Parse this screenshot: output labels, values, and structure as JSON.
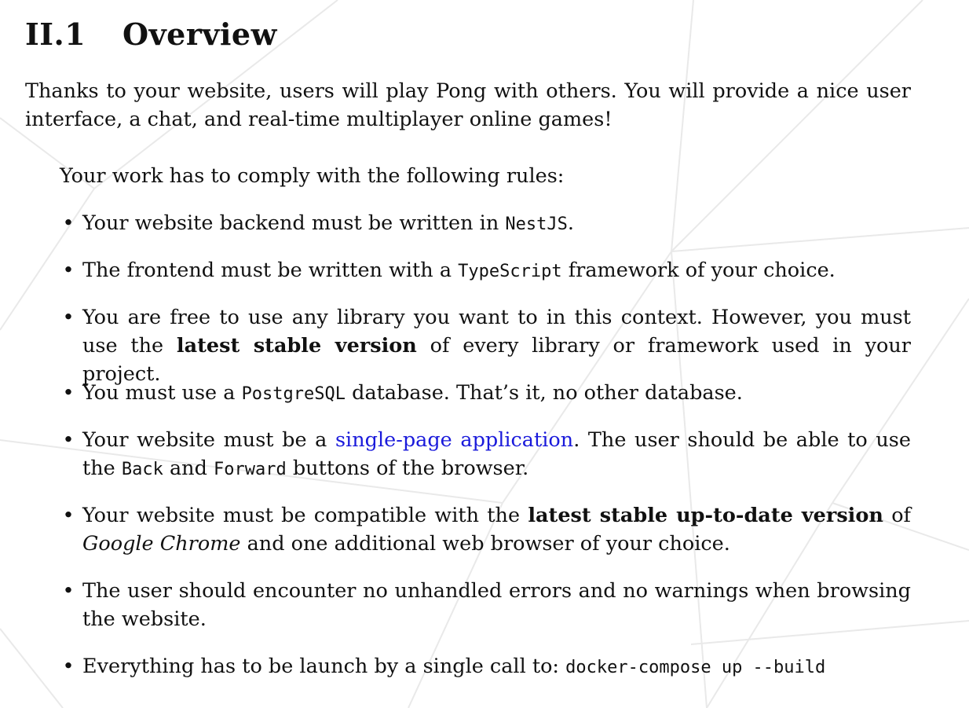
{
  "section": {
    "number": "II.1",
    "title": "Overview"
  },
  "intro": {
    "text": "Thanks to your website, users will play Pong with others. You will provide a nice user interface, a chat, and real-time multiplayer online games!"
  },
  "rules_lead": "Your work has to comply with the following rules:",
  "bullet_symbol": "•",
  "rules": [
    {
      "before": "Your website backend must be written in ",
      "code": "NestJS",
      "after": "."
    },
    {
      "before": "The frontend must be written with a ",
      "code": "TypeScript",
      "after": " framework of your choice."
    },
    {
      "before": "You are free to use any library you want to in this context. However, you must use the ",
      "bold": "latest stable version",
      "after": " of every library or framework used in your project."
    },
    {
      "before": "You must use a ",
      "code": "PostgreSQL",
      "after": " database. That’s it, no other database."
    },
    {
      "before": "Your website must be a ",
      "link": "single-page application",
      "middle": ". The user should be able to use the ",
      "code1": "Back",
      "and": " and ",
      "code2": "Forward",
      "after": " buttons of the browser."
    },
    {
      "before": "Your website must be compatible with the ",
      "bold": "latest stable up-to-date version",
      "middle": " of ",
      "italic": "Google Chrome",
      "after": " and one additional web browser of your choice."
    },
    {
      "text": "The user should encounter no unhandled errors and no warnings when browsing the website."
    },
    {
      "before": "Everything has to be launch by a single call to: ",
      "code": "docker-compose up --build"
    }
  ],
  "colors": {
    "text": "#111111",
    "link": "#1a1adb",
    "background_lines": "#e9e9e9"
  }
}
